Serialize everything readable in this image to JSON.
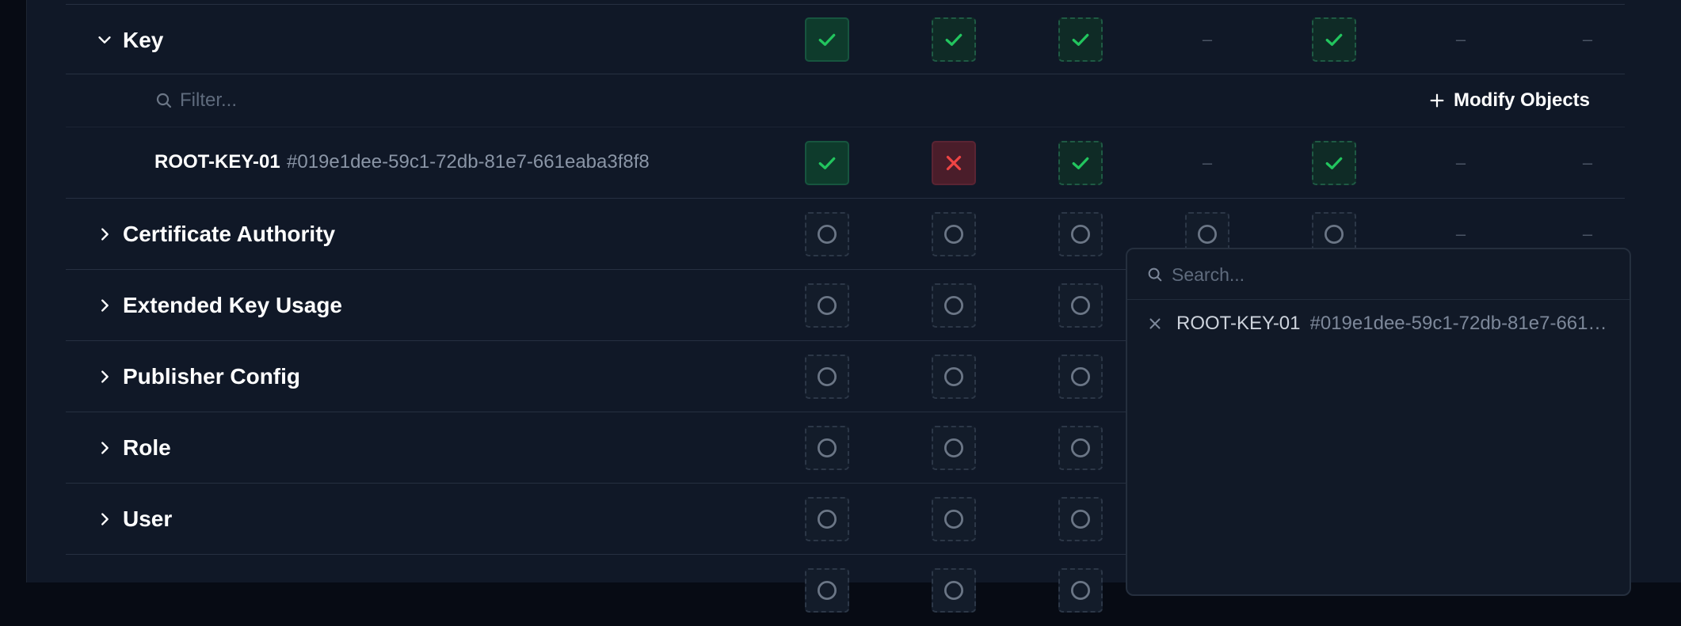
{
  "permissions": {
    "columns": 7,
    "sections": [
      {
        "label": "Key",
        "expanded": true,
        "cells": [
          "granted",
          "partial",
          "partial",
          "none",
          "partial",
          "none",
          "none"
        ],
        "filter_placeholder": "Filter...",
        "modify_label": "Modify Objects",
        "objects": [
          {
            "name": "ROOT-KEY-01",
            "id": "#019e1dee-59c1-72db-81e7-661eaba3f8f8",
            "cells": [
              "granted",
              "denied",
              "partial",
              "none",
              "partial",
              "none",
              "none"
            ]
          }
        ]
      },
      {
        "label": "Certificate Authority",
        "expanded": false,
        "cells": [
          "empty",
          "empty",
          "empty",
          "empty",
          "empty",
          "none",
          "none"
        ]
      },
      {
        "label": "Extended Key Usage",
        "expanded": false,
        "cells": [
          "empty",
          "empty",
          "empty",
          "hidden",
          "hidden",
          "hidden",
          "hidden"
        ]
      },
      {
        "label": "Publisher Config",
        "expanded": false,
        "cells": [
          "empty",
          "empty",
          "empty",
          "hidden",
          "hidden",
          "hidden",
          "hidden"
        ]
      },
      {
        "label": "Role",
        "expanded": false,
        "cells": [
          "empty",
          "empty",
          "empty",
          "hidden",
          "hidden",
          "hidden",
          "hidden"
        ]
      },
      {
        "label": "User",
        "expanded": false,
        "cells": [
          "empty",
          "empty",
          "empty",
          "hidden",
          "hidden",
          "hidden",
          "hidden"
        ]
      },
      {
        "label": "",
        "expanded": false,
        "cells": [
          "empty",
          "empty",
          "empty",
          "hidden",
          "hidden",
          "hidden",
          "hidden"
        ]
      }
    ]
  },
  "object_picker": {
    "search_placeholder": "Search...",
    "selected": [
      {
        "name": "ROOT-KEY-01",
        "id": "#019e1dee-59c1-72db-81e7-661eaba3f8f8"
      }
    ]
  },
  "colors": {
    "background": "#101827",
    "granted": "#22c55e",
    "denied": "#ef4444",
    "empty_ring": "#6b7686",
    "divider": "#263041"
  },
  "icons": {
    "expanded": "chevron-down-icon",
    "collapsed": "chevron-right-icon",
    "granted": "check-icon",
    "partial": "check-icon",
    "denied": "x-icon",
    "empty": "circle-icon",
    "none": "dash-icon",
    "filter": "search-icon",
    "modify": "plus-icon",
    "remove": "close-icon"
  }
}
